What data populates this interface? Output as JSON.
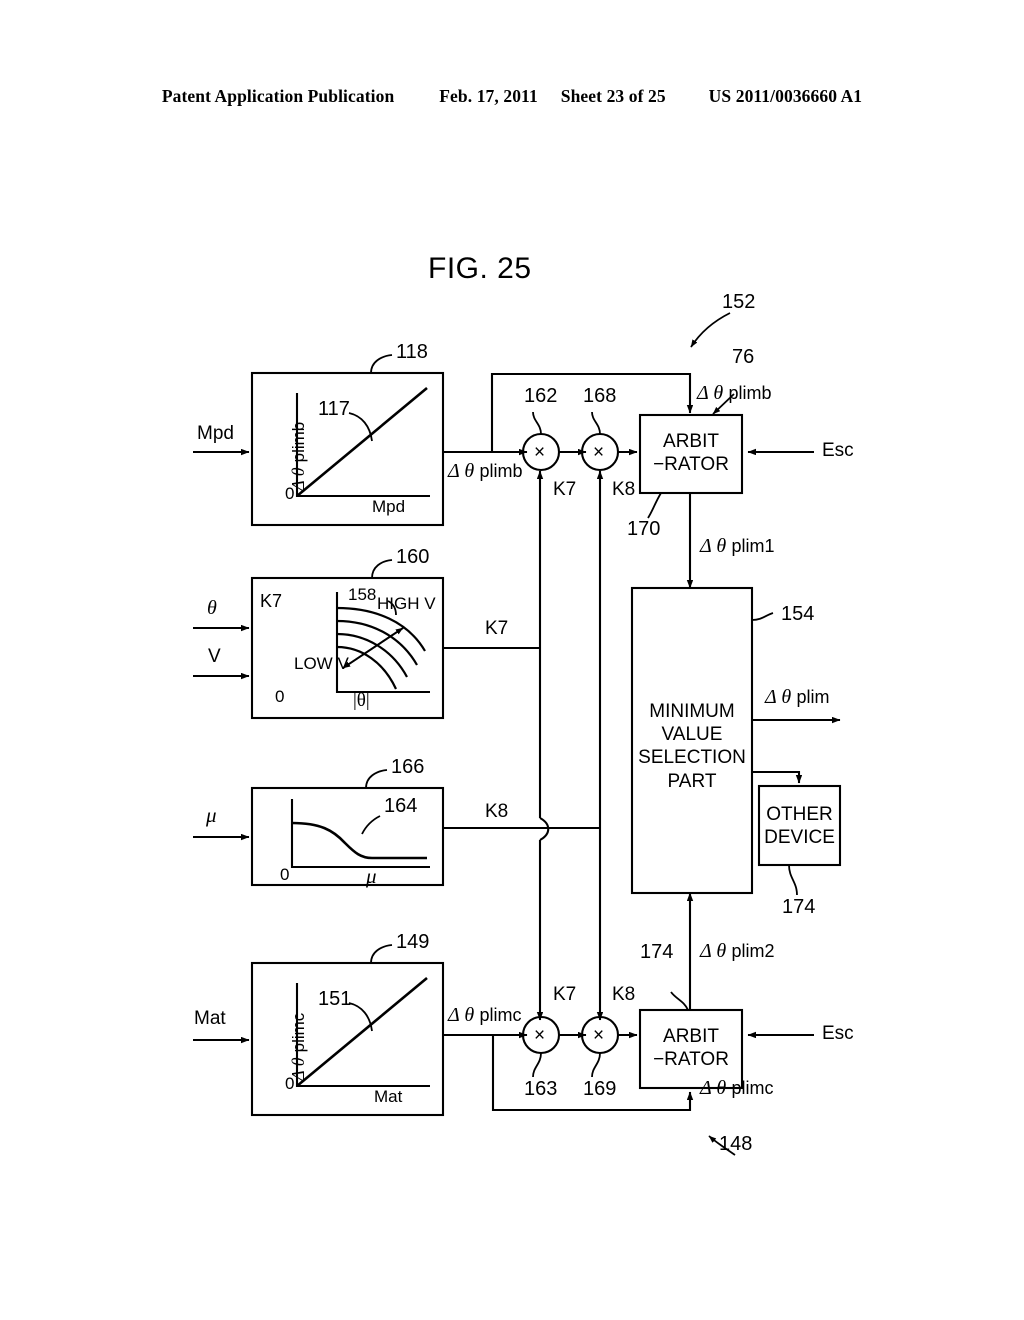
{
  "header": {
    "publication": "Patent Application Publication",
    "date": "Feb. 17, 2011",
    "sheet": "Sheet 23 of 25",
    "patent_number": "US 2011/0036660 A1"
  },
  "figure": {
    "title": "FIG. 25"
  },
  "inputs": {
    "mpd": "Mpd",
    "theta": "θ",
    "v": "V",
    "mu": "μ",
    "mat": "Mat",
    "esc_top": "Esc",
    "esc_bottom": "Esc"
  },
  "blocks": {
    "map_plimb": {
      "ref": "118",
      "curve_ref": "117",
      "y_axis": "Δ θ plimb",
      "x_axis": "Mpd",
      "origin": "0"
    },
    "map_k7": {
      "ref": "160",
      "curve_ref": "158",
      "gain_label": "K7",
      "high_label": "HIGH V",
      "low_label": "LOW V",
      "x_axis": "|θ|",
      "origin": "0"
    },
    "map_k8": {
      "ref": "166",
      "curve_ref": "164",
      "x_axis": "μ",
      "origin": "0"
    },
    "map_plimc": {
      "ref": "149",
      "curve_ref": "151",
      "y_axis": "Δ θ plimc",
      "x_axis": "Mat",
      "origin": "0"
    },
    "arbitrator_top": {
      "ref": "170",
      "line1": "ARBIT",
      "line2": "−RATOR"
    },
    "arbitrator_bottom": {
      "ref": "174",
      "line1": "ARBIT",
      "line2": "−RATOR"
    },
    "minimum_value_selection": {
      "ref": "154",
      "line1": "MINIMUM",
      "line2": "VALUE",
      "line3": "SELECTION",
      "line4": "PART"
    },
    "other_device": {
      "ref": "174",
      "line1": "OTHER",
      "line2": "DEVICE"
    }
  },
  "multipliers": {
    "top_k7": {
      "ref": "162",
      "glyph": "×"
    },
    "top_k8": {
      "ref": "168",
      "glyph": "×"
    },
    "bottom_k7": {
      "ref": "163",
      "glyph": "×"
    },
    "bottom_k8": {
      "ref": "169",
      "glyph": "×"
    }
  },
  "signals": {
    "plimb_out": "Δ θ plimb",
    "plimb_feedback": "Δ θ plimb",
    "plim1": "Δ θ plim1",
    "plim": "Δ θ plim",
    "plim2": "Δ θ plim2",
    "plimc_out": "Δ θ plimc",
    "plimc_feedback": "Δ θ plimc",
    "k7_top": "K7",
    "k8_top": "K8",
    "k7_mid": "K7",
    "k8_mid": "K8",
    "k7_bottom": "K7",
    "k8_bottom": "K8"
  },
  "ref_numerals": {
    "system_152": "152",
    "feedback_76": "76",
    "group_148": "148"
  },
  "colors": {
    "line": "#000000",
    "background": "#ffffff"
  }
}
